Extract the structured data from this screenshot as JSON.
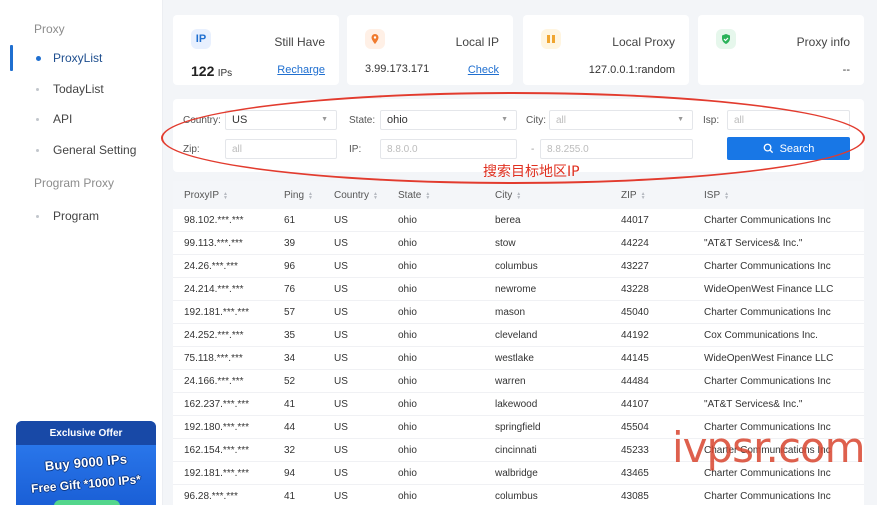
{
  "sidebar": {
    "section_proxy": "Proxy",
    "items": [
      {
        "label": "ProxyList",
        "active": true
      },
      {
        "label": "TodayList",
        "active": false
      },
      {
        "label": "API",
        "active": false
      },
      {
        "label": "General Setting",
        "active": false
      }
    ],
    "section_program": "Program Proxy",
    "program_items": [
      {
        "label": "Program"
      }
    ],
    "promo": {
      "title": "Exclusive Offer",
      "line1": "Buy 9000 IPs",
      "line2": "Free Gift *1000 IPs*"
    }
  },
  "cards": {
    "ip": {
      "icon": "IP",
      "label": "Still Have",
      "count": "122",
      "unit": "IPs",
      "link": "Recharge"
    },
    "local_ip": {
      "icon": "location-icon",
      "label": "Local IP",
      "value": "3.99.173.171",
      "link": "Check"
    },
    "local_proxy": {
      "icon": "proxy-icon",
      "label": "Local Proxy",
      "value": "127.0.0.1:random"
    },
    "proxy_info": {
      "icon": "shield-icon",
      "label": "Proxy info",
      "value": "--"
    }
  },
  "filters": {
    "country_label": "Country:",
    "country_value": "US",
    "state_label": "State:",
    "state_value": "ohio",
    "city_label": "City:",
    "city_placeholder": "all",
    "isp_label": "Isp:",
    "isp_placeholder": "all",
    "zip_label": "Zip:",
    "zip_placeholder": "all",
    "ip_label": "IP:",
    "ip_from": "8.8.0.0",
    "ip_sep": "-",
    "ip_to": "8.8.255.0",
    "search_label": "Search"
  },
  "annotation": "搜索目标地区IP",
  "watermark": "ivpsr.com",
  "table": {
    "headers": [
      "ProxyIP",
      "Ping",
      "Country",
      "State",
      "City",
      "ZIP",
      "ISP"
    ],
    "rows": [
      [
        "98.102.***.***",
        "61",
        "US",
        "ohio",
        "berea",
        "44017",
        "Charter Communications Inc"
      ],
      [
        "99.113.***.***",
        "39",
        "US",
        "ohio",
        "stow",
        "44224",
        "\"AT&T Services& Inc.\""
      ],
      [
        "24.26.***.***",
        "96",
        "US",
        "ohio",
        "columbus",
        "43227",
        "Charter Communications Inc"
      ],
      [
        "24.214.***.***",
        "76",
        "US",
        "ohio",
        "newrome",
        "43228",
        "WideOpenWest Finance LLC"
      ],
      [
        "192.181.***.***",
        "57",
        "US",
        "ohio",
        "mason",
        "45040",
        "Charter Communications Inc"
      ],
      [
        "24.252.***.***",
        "35",
        "US",
        "ohio",
        "cleveland",
        "44192",
        "Cox Communications Inc."
      ],
      [
        "75.118.***.***",
        "34",
        "US",
        "ohio",
        "westlake",
        "44145",
        "WideOpenWest Finance LLC"
      ],
      [
        "24.166.***.***",
        "52",
        "US",
        "ohio",
        "warren",
        "44484",
        "Charter Communications Inc"
      ],
      [
        "162.237.***.***",
        "41",
        "US",
        "ohio",
        "lakewood",
        "44107",
        "\"AT&T Services& Inc.\""
      ],
      [
        "192.180.***.***",
        "44",
        "US",
        "ohio",
        "springfield",
        "45504",
        "Charter Communications Inc"
      ],
      [
        "162.154.***.***",
        "32",
        "US",
        "ohio",
        "cincinnati",
        "45233",
        "Charter Communications Inc"
      ],
      [
        "192.181.***.***",
        "94",
        "US",
        "ohio",
        "walbridge",
        "43465",
        "Charter Communications Inc"
      ],
      [
        "96.28.***.***",
        "41",
        "US",
        "ohio",
        "columbus",
        "43085",
        "Charter Communications Inc"
      ]
    ]
  },
  "colors": {
    "accent": "#1877e6",
    "annotation": "#e23b2e"
  }
}
